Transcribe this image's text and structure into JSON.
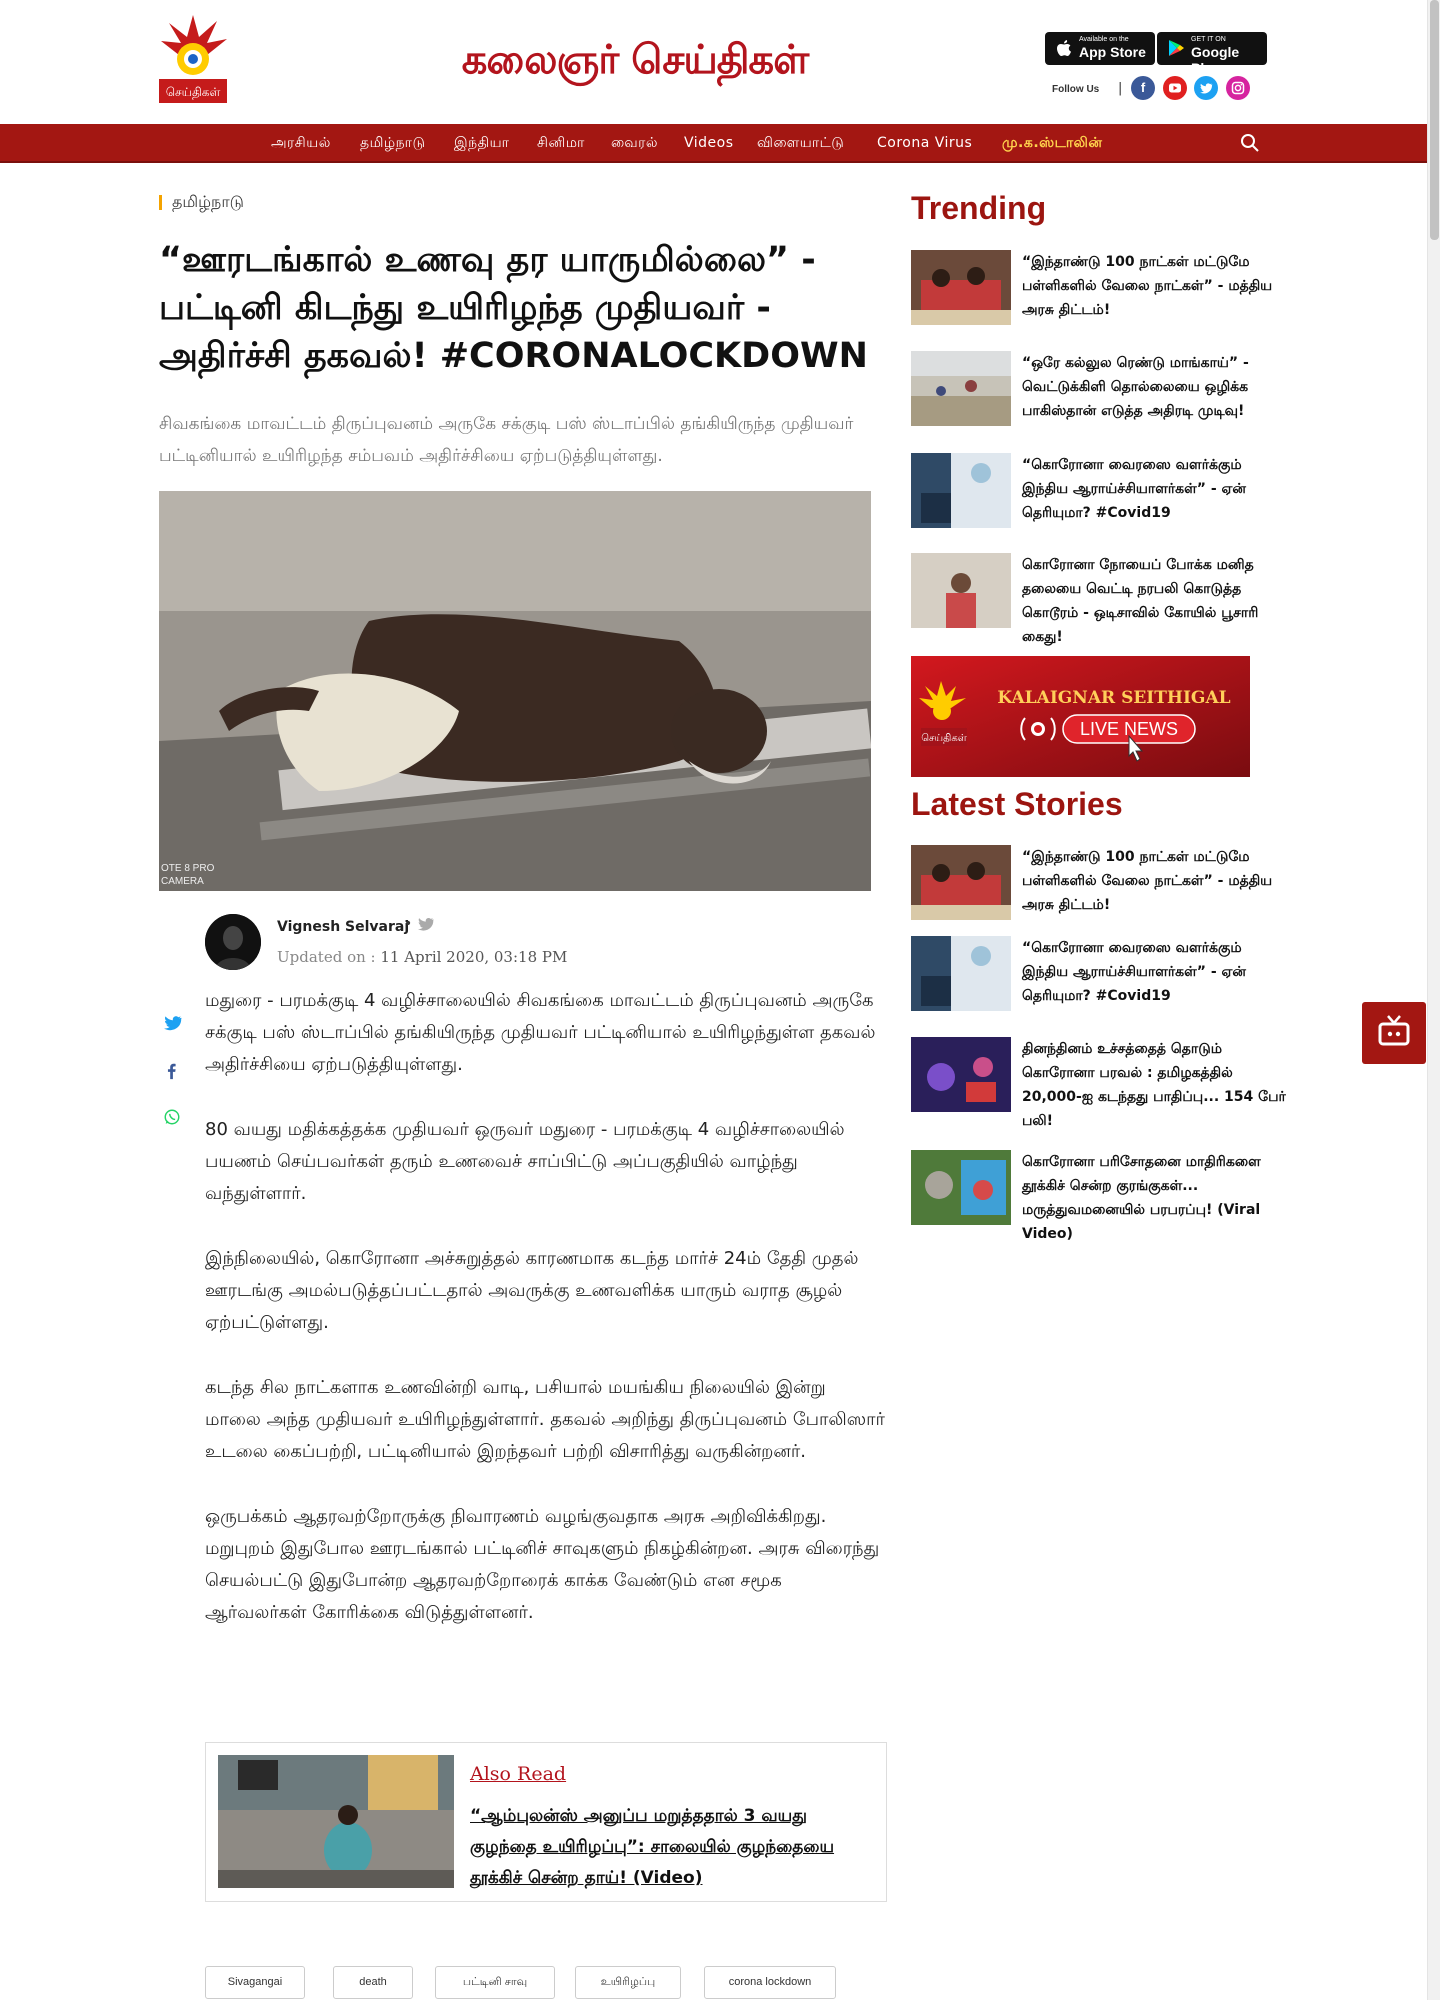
{
  "header": {
    "masthead": "கலைஞர் செய்திகள்",
    "logo_text": "செய்திகள்",
    "app_store": {
      "small": "Available on the",
      "big": "App Store"
    },
    "google_play": {
      "small": "GET IT ON",
      "big": "Google Play"
    },
    "follow_label": "Follow Us",
    "follow_sep": "|"
  },
  "nav": {
    "items": [
      "அரசியல்",
      "தமிழ்நாடு",
      "இந்தியா",
      "சினிமா",
      "வைரல்",
      "Videos",
      "விளையாட்டு",
      "Corona Virus",
      "மு.க.ஸ்டாலின்"
    ]
  },
  "article": {
    "section": "தமிழ்நாடு",
    "headline": "“ஊரடங்கால் உணவு தர யாருமில்லை” - பட்டினி கிடந்து உயிரிழந்த முதியவர் - அதிர்ச்சி தகவல்! #CORONALOCKDOWN",
    "summary": "சிவகங்கை மாவட்டம் திருப்புவனம் அருகே சக்குடி பஸ் ஸ்டாப்பில் தங்கியிருந்த முதியவர் பட்டினியால் உயிரிழந்த சம்பவம் அதிர்ச்சியை ஏற்படுத்தியுள்ளது.",
    "image_watermark": "OTE 8 PRO\nCAMERA",
    "author": "Vignesh Selvaraj",
    "author_dot": "•",
    "updated_label": "Updated on :",
    "updated_value": "11 April 2020, 03:18 PM",
    "paragraphs": [
      "மதுரை - பரமக்குடி 4 வழிச்சாலையில் சிவகங்கை மாவட்டம் திருப்புவனம் அருகே சக்குடி பஸ் ஸ்டாப்பில் தங்கியிருந்த முதியவர் பட்டினியால் உயிரிழந்துள்ள தகவல் அதிர்ச்சியை ஏற்படுத்தியுள்ளது.",
      "80 வயது மதிக்கத்தக்க முதியவர் ஒருவர் மதுரை - பரமக்குடி 4 வழிச்சாலையில் பயணம் செய்பவர்கள் தரும் உணவைச் சாப்பிட்டு அப்பகுதியில் வாழ்ந்து வந்துள்ளார்.",
      "இந்நிலையில், கொரோனா அச்சுறுத்தல் காரணமாக கடந்த மார்ச் 24ம் தேதி முதல் ஊரடங்கு அமல்படுத்தப்பட்டதால் அவருக்கு உணவளிக்க யாரும் வராத சூழல் ஏற்பட்டுள்ளது.",
      "கடந்த சில நாட்களாக உணவின்றி வாடி, பசியால் மயங்கிய நிலையில் இன்று மாலை அந்த முதியவர் உயிரிழந்துள்ளார். தகவல் அறிந்து திருப்புவனம் போலிஸார் உடலை கைப்பற்றி, பட்டினியால் இறந்தவர் பற்றி விசாரித்து வருகின்றனர்.",
      "ஒருபக்கம் ஆதரவற்றோருக்கு நிவாரணம் வழங்குவதாக அரசு அறிவிக்கிறது. மறுபுறம் இதுபோல ஊரடங்கால் பட்டினிச் சாவுகளும் நிகழ்கின்றன. அரசு விரைந்து செயல்பட்டு இதுபோன்ற ஆதரவற்றோரைக் காக்க வேண்டும் என சமூக ஆர்வலர்கள் கோரிக்கை விடுத்துள்ளனர்."
    ],
    "also_read": {
      "label": "Also Read",
      "title": "“ஆம்புலன்ஸ் அனுப்ப மறுத்ததால் 3 வயது குழந்தை உயிரிழப்பு”: சாலையில் குழந்தையை தூக்கிச் சென்ற தாய்! (Video)"
    },
    "tags": [
      "Sivagangai",
      "death",
      "பட்டினி சாவு",
      "உயிரிழப்பு",
      "corona lockdown"
    ]
  },
  "sidebar": {
    "trending_heading": "Trending",
    "trending": [
      "“இந்தாண்டு 100 நாட்கள் மட்டுமே பள்ளிகளில் வேலை நாட்கள்” - மத்திய அரசு திட்டம்!",
      "“ஒரே கல்லுல ரெண்டு மாங்காய்” - வெட்டுக்கிளி தொல்லையை ஒழிக்க பாகிஸ்தான் எடுத்த அதிரடி முடிவு!",
      "“கொரோனா வைரஸை வளர்க்கும் இந்திய ஆராய்ச்சியாளர்கள்” - ஏன் தெரியுமா? #Covid19",
      "கொரோனா நோயைப் போக்க மனித தலையை வெட்டி நரபலி கொடுத்த கொடூரம் - ஒடிசாவில் கோயில் பூசாரி கைது!"
    ],
    "live_banner": {
      "title": "KALAIGNAR SEITHIGAL",
      "button": "LIVE NEWS",
      "logo_text": "செய்திகள்"
    },
    "latest_heading": "Latest Stories",
    "latest": [
      "“இந்தாண்டு 100 நாட்கள் மட்டுமே பள்ளிகளில் வேலை நாட்கள்” - மத்திய அரசு திட்டம்!",
      "“கொரோனா வைரஸை வளர்க்கும் இந்திய ஆராய்ச்சியாளர்கள்” - ஏன் தெரியுமா? #Covid19",
      "தினந்தினம் உச்சத்தைத் தொடும் கொரோனா பரவல் : தமிழகத்தில் 20,000-ஐ கடந்தது பாதிப்பு... 154 பேர் பலி!",
      "கொரோனா பரிசோதனை மாதிரிகளை தூக்கிச் சென்ற குரங்குகள்... மருத்துவமனையில் பரபரப்பு! (Viral Video)"
    ]
  },
  "colors": {
    "brand_red": "#a31712",
    "accent_yellow": "#ffd34d",
    "section_bar": "#f4a300"
  }
}
